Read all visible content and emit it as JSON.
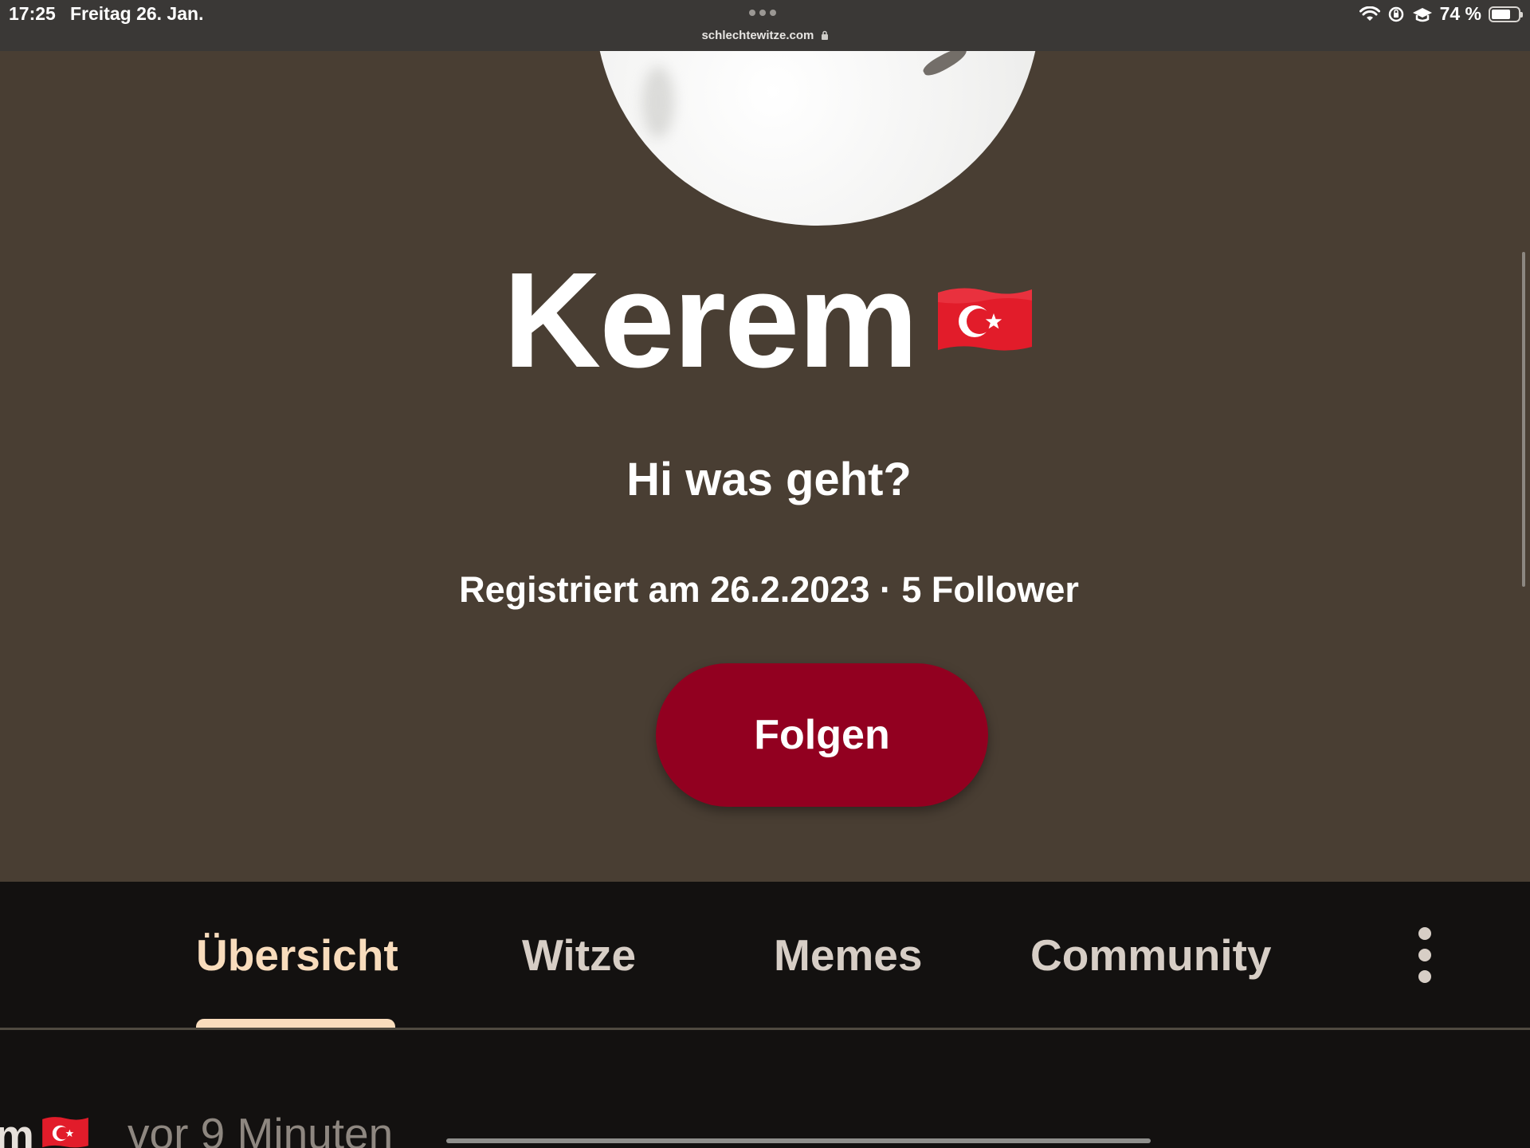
{
  "status_bar": {
    "time": "17:25",
    "date": "Freitag 26. Jan.",
    "url": "schlechtewitze.com",
    "battery_text": "74 %",
    "battery_level": 0.74
  },
  "profile": {
    "name": "Kerem",
    "bio": "Hi was geht?",
    "meta": "Registriert am 26.2.2023 · 5 Follower",
    "follow_label": "Folgen"
  },
  "tabs": [
    {
      "label": "Übersicht",
      "active": true
    },
    {
      "label": "Witze",
      "active": false
    },
    {
      "label": "Memes",
      "active": false
    },
    {
      "label": "Community",
      "active": false
    }
  ],
  "feed": {
    "author_fragment": "m",
    "time": "vor 9 Minuten"
  },
  "colors": {
    "profile_bg": "#493e33",
    "follow_button": "#920020",
    "tab_active": "#f8dcbc",
    "tab_inactive": "#d7cec6",
    "page_bg": "#131110"
  }
}
